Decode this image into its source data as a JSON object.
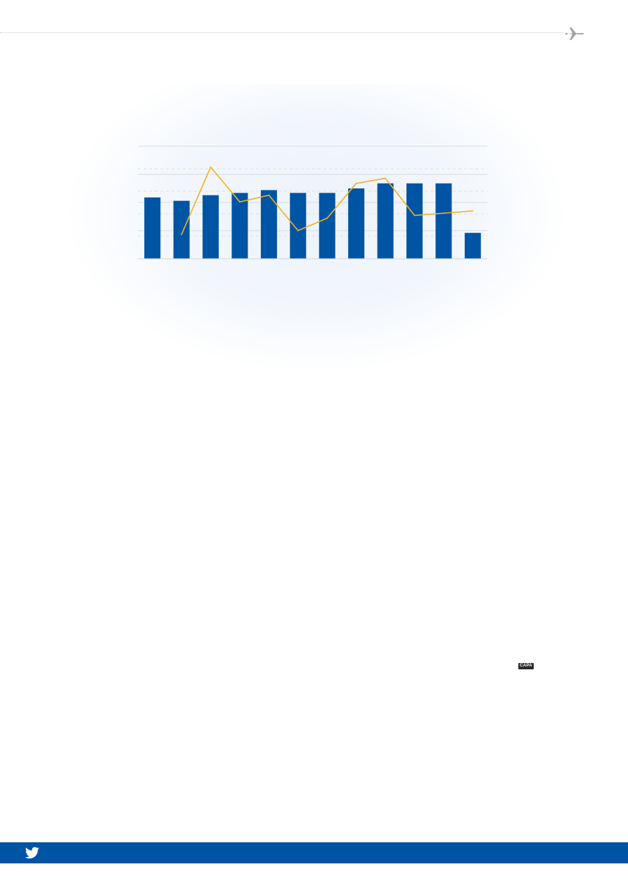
{
  "brand": {
    "capa_logo": "CAPA",
    "accent_blue": "#0054a4",
    "line_color": "#f2b01e"
  },
  "icons": [
    "plane-icon",
    "twitter-icon",
    "capa-logo"
  ],
  "chart_data": {
    "type": "bar",
    "title": "",
    "xlabel": "",
    "ylabel": "",
    "ylim": [
      0,
      100
    ],
    "grid": true,
    "categories": [
      "",
      "",
      "",
      "",
      "",
      "",
      "",
      "",
      "",
      "",
      "",
      ""
    ],
    "series": [
      {
        "type": "bar",
        "color": "#0054a4",
        "values": [
          54.5,
          51.5,
          56.5,
          58.5,
          61,
          58.5,
          58.5,
          62.5,
          67,
          67,
          67,
          23
        ]
      },
      {
        "type": "line",
        "color": "#f2b01e",
        "values": [
          null,
          21.5,
          81.5,
          50.5,
          56.5,
          25,
          36,
          67,
          71.5,
          38.5,
          40.5,
          42.5
        ]
      }
    ]
  }
}
